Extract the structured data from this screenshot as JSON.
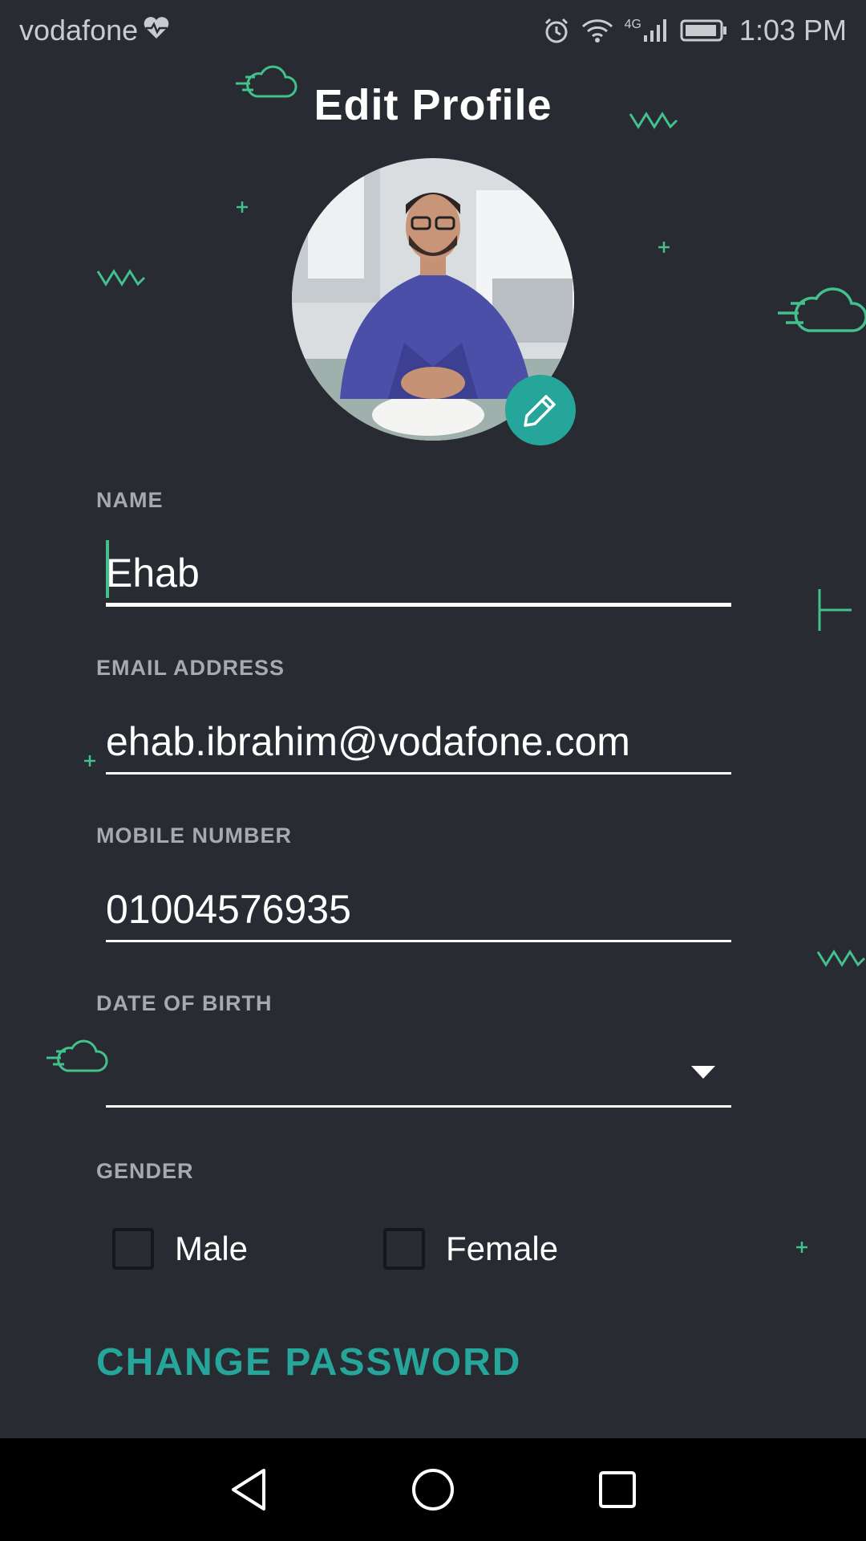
{
  "status_bar": {
    "carrier": "vodafone",
    "network": "4G",
    "time": "1:03 PM"
  },
  "header": {
    "title": "Edit Profile"
  },
  "form": {
    "name": {
      "label": "NAME",
      "value": "Ehab"
    },
    "email": {
      "label": "EMAIL ADDRESS",
      "value": "ehab.ibrahim@vodafone.com"
    },
    "mobile": {
      "label": "MOBILE NUMBER",
      "value": "01004576935"
    },
    "dob": {
      "label": "DATE OF BIRTH",
      "value": ""
    },
    "gender": {
      "label": "GENDER",
      "options": [
        "Male",
        "Female"
      ],
      "selected": null
    }
  },
  "actions": {
    "change_password": "CHANGE PASSWORD"
  },
  "colors": {
    "background": "#282b31",
    "accent": "#26a59a",
    "decoration": "#43c08c"
  },
  "icons": {
    "edit_photo": "pencil-icon",
    "nav": [
      "back-icon",
      "home-icon",
      "recents-icon"
    ]
  }
}
